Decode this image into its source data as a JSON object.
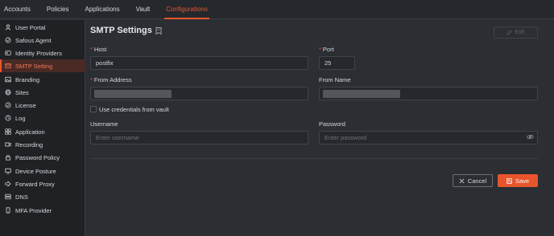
{
  "top_nav": {
    "tabs": [
      {
        "label": "Accounts"
      },
      {
        "label": "Policies"
      },
      {
        "label": "Applications"
      },
      {
        "label": "Vault"
      },
      {
        "label": "Configurations"
      }
    ],
    "active": "Configurations"
  },
  "sidebar": {
    "items": [
      {
        "label": "User Portal",
        "icon": "user-icon"
      },
      {
        "label": "Safous Agent",
        "icon": "agent-icon"
      },
      {
        "label": "Identity Providers",
        "icon": "id-card-icon"
      },
      {
        "label": "SMTP Setting",
        "icon": "mail-icon"
      },
      {
        "label": "Branding",
        "icon": "image-icon"
      },
      {
        "label": "Sites",
        "icon": "globe-icon"
      },
      {
        "label": "License",
        "icon": "license-icon"
      },
      {
        "label": "Log",
        "icon": "log-icon"
      },
      {
        "label": "Application",
        "icon": "application-icon"
      },
      {
        "label": "Recording",
        "icon": "recording-icon"
      },
      {
        "label": "Password Policy",
        "icon": "password-icon"
      },
      {
        "label": "Device Posture",
        "icon": "device-icon"
      },
      {
        "label": "Forward Proxy",
        "icon": "proxy-icon"
      },
      {
        "label": "DNS",
        "icon": "dns-icon"
      },
      {
        "label": "MFA Provider",
        "icon": "mfa-icon"
      }
    ],
    "active": "SMTP Setting"
  },
  "main": {
    "title": "SMTP Settings",
    "edit_label": "Edit",
    "host": {
      "label": "Host",
      "value": "postfix"
    },
    "port": {
      "label": "Port",
      "value": "25"
    },
    "from_address": {
      "label": "From Address"
    },
    "from_name": {
      "label": "From Name"
    },
    "use_credentials_label": "Use credentials from vault",
    "username": {
      "label": "Username",
      "placeholder": "Enter username"
    },
    "password": {
      "label": "Password",
      "placeholder": "Enter password"
    },
    "cancel_label": "Cancel",
    "save_label": "Save"
  },
  "colors": {
    "accent": "#e8552b",
    "background": "#2b2e33",
    "sidebar": "#1f2125"
  }
}
